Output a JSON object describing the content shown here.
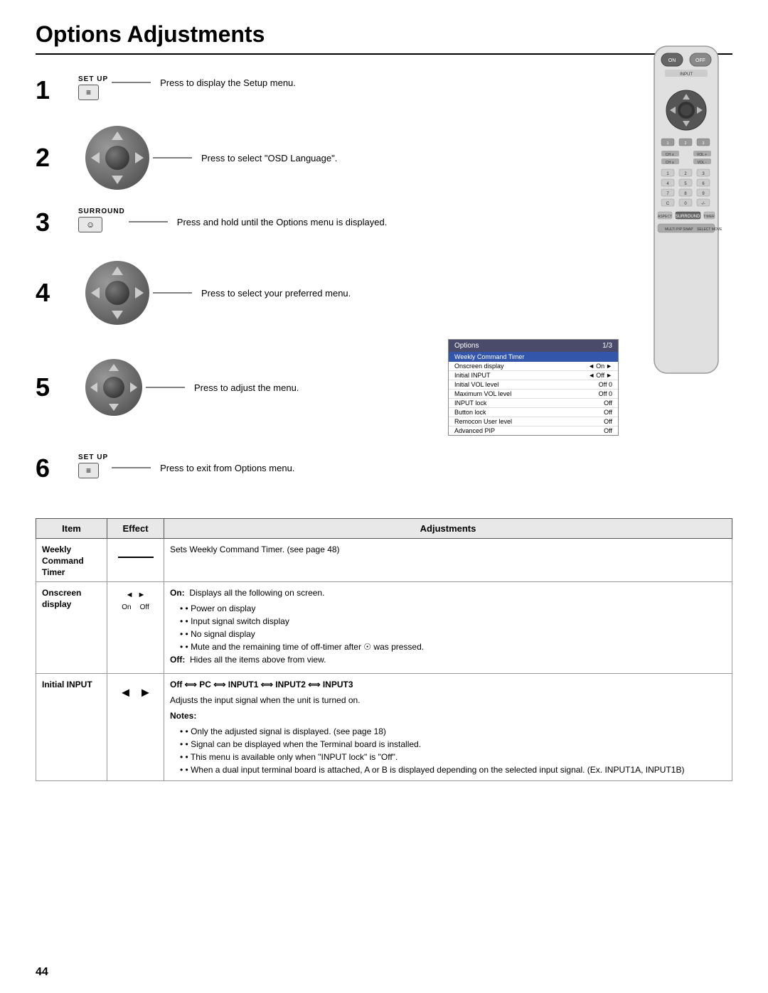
{
  "title": "Options Adjustments",
  "steps": [
    {
      "number": "1",
      "button_label": "SET UP",
      "button_icon": "≡",
      "text": "Press to display the Setup menu."
    },
    {
      "number": "2",
      "has_dpad": true,
      "text": "Press to select \"OSD Language\"."
    },
    {
      "number": "3",
      "button_label": "SURROUND",
      "button_icon": "↻",
      "text": "Press and hold until the Options menu is displayed."
    },
    {
      "number": "4",
      "has_dpad": true,
      "text": "Press to select your preferred menu."
    },
    {
      "number": "5",
      "has_dpad": true,
      "text": "Press to adjust the menu."
    },
    {
      "number": "6",
      "button_label": "SET UP",
      "button_icon": "≡",
      "text": "Press to exit from Options menu."
    }
  ],
  "options_menu": {
    "title": "Options",
    "page": "1/3",
    "rows": [
      {
        "name": "Weekly Command Timer",
        "value": "",
        "highlighted": true
      },
      {
        "name": "Onscreen display",
        "value": "On",
        "has_arrows": true,
        "highlighted": false
      },
      {
        "name": "Initial INPUT",
        "value": "Off",
        "has_arrows": true,
        "highlighted": false
      },
      {
        "name": "Initial VOL level",
        "value": "Off  0",
        "highlighted": false
      },
      {
        "name": "Maximum VOL level",
        "value": "Off  0",
        "highlighted": false
      },
      {
        "name": "INPUT lock",
        "value": "Off",
        "highlighted": false
      },
      {
        "name": "Button lock",
        "value": "Off",
        "highlighted": false
      },
      {
        "name": "Remocon User level",
        "value": "Off",
        "highlighted": false
      },
      {
        "name": "Advanced PIP",
        "value": "Off",
        "highlighted": false
      }
    ]
  },
  "table": {
    "headers": [
      "Item",
      "Effect",
      "Adjustments"
    ],
    "rows": [
      {
        "item": "Weekly\nCommand\nTimer",
        "effect_type": "line",
        "adjustments": "Sets Weekly Command Timer. (see page 48)"
      },
      {
        "item": "Onscreen\ndisplay",
        "effect_type": "arrows",
        "adjustments_html": true,
        "adjustments": {
          "on_label": "On:",
          "on_text": "Displays all the following on screen.",
          "bullets": [
            "Power on display",
            "Input signal switch display",
            "No signal display",
            "Mute and the remaining time of off-timer after the button was pressed."
          ],
          "off_label": "Off:",
          "off_text": "Hides all the items above from view."
        },
        "arrow_labels": [
          "On",
          "Off"
        ]
      },
      {
        "item": "Initial INPUT",
        "effect_type": "arrows_lr",
        "adjustments_html": true,
        "adjustments": {
          "main": "Off ⟺ PC ⟺ INPUT1 ⟺ INPUT2 ⟺ INPUT3",
          "sub": "Adjusts the input signal when the unit is turned on.",
          "notes_label": "Notes:",
          "notes": [
            "Only the adjusted signal is displayed. (see page 18)",
            "Signal can be displayed when the Terminal board is installed.",
            "This menu is available only when \"INPUT lock\" is \"Off\".",
            "When a dual input terminal board is attached, A or B is displayed depending on the selected input signal. (Ex. INPUT1A, INPUT1B)"
          ]
        }
      }
    ]
  },
  "page_number": "44"
}
